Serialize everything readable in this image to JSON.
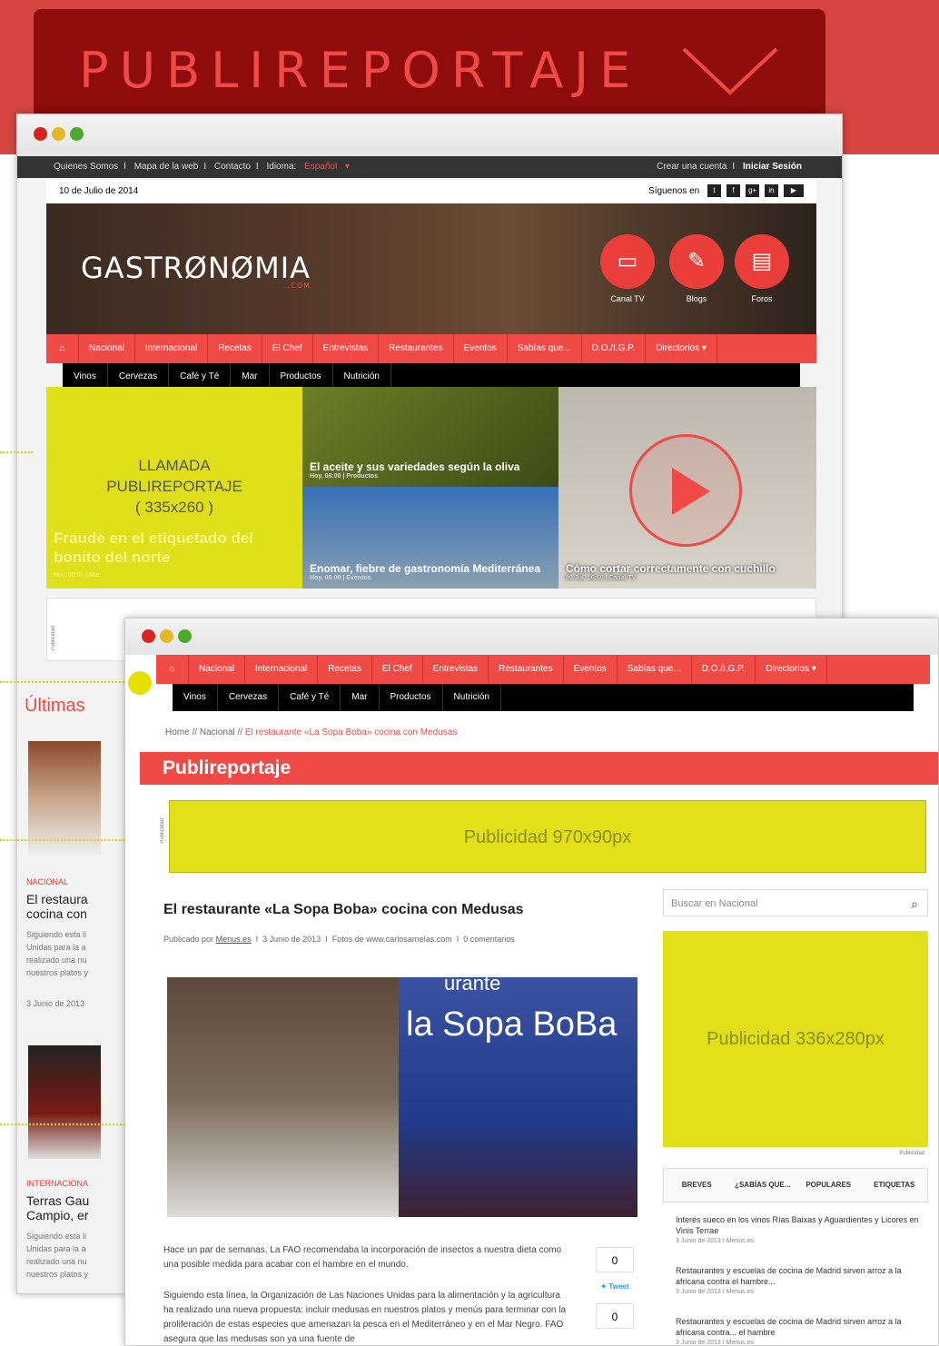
{
  "banner": {
    "title": "PUBLIREPORTAJE"
  },
  "colors": {
    "accent": "#f04a46",
    "ad_yellow": "#e1e01a",
    "banner_dark": "#8e0c0c"
  },
  "window1": {
    "topbar": {
      "links": [
        "Quienes Somos",
        "Mapa de la web",
        "Contacto"
      ],
      "idioma_label": "Idioma:",
      "idioma_value": "Español",
      "crear": "Crear una cuenta",
      "iniciar": "Iniciar Sesión"
    },
    "date": "10 de Julio de 2014",
    "siguenos": "Síguenos en",
    "logo": "GASTRØNØMIA",
    "logo_suffix": ".COM",
    "channels": [
      "Canal TV",
      "Blogs",
      "Foros"
    ],
    "nav": [
      "Nacional",
      "Internacional",
      "Recetas",
      "El Chef",
      "Entrevistas",
      "Restaurantes",
      "Eventos",
      "Sabías que...",
      "D.O./I.G.P.",
      "Directorios"
    ],
    "subnav": [
      "Vinos",
      "Cervezas",
      "Café y Té",
      "Mar",
      "Productos",
      "Nutrición"
    ],
    "tile1": {
      "callout1": "LLAMADA",
      "callout2": "PUBLIREPORTAJE",
      "callout3": "( 335x260 )",
      "title": "Fraude en el etiquetado del bonito del norte",
      "meta": "Hoy, 08:00 | Mar"
    },
    "tile2a": {
      "title": "El aceite y sus variedades según la oliva",
      "meta": "Hoy, 08:00 | Productos"
    },
    "tile2b": {
      "title": "Enomar, fiebre de gastronomía Mediterránea",
      "meta": "Hoy, 08:00 | Eventos"
    },
    "tile3": {
      "title": "Cómo cortar correctamente con cuchillo",
      "meta": "09 Jul, 16:50 | Canal TV"
    },
    "publicidad": "Publicidad",
    "ultimas": "Últimas",
    "card1": {
      "tag": "NACIONAL",
      "title1": "El restaura",
      "title2": "cocina con",
      "text": [
        "Siguiendo esta li",
        "Unidas para la a",
        "realizado una nu",
        "nuestros platos y"
      ],
      "date": "3 Junio de 2013"
    },
    "card2": {
      "tag": "INTERNACIONA",
      "title1": "Terras Gau",
      "title2": "Campio, er",
      "text": [
        "Siguiendo esta li",
        "Unidas para la a",
        "realizado una nu",
        "nuestros platos y"
      ]
    }
  },
  "window2": {
    "nav": [
      "Nacional",
      "Internacional",
      "Recetas",
      "El Chef",
      "Entrevistas",
      "Restaurantes",
      "Eventos",
      "Sabías que...",
      "D.O./I.G.P.",
      "Directorios"
    ],
    "subnav": [
      "Vinos",
      "Cervezas",
      "Café y Té",
      "Mar",
      "Productos",
      "Nutrición"
    ],
    "breadcrumb": {
      "home": "Home",
      "sep": "//",
      "section": "Nacional",
      "current": "El restaurante «La Sopa Boba» cocina con Medusas"
    },
    "section_title": "Publireportaje",
    "ad_top": "Publicidad 970x90px",
    "publicidad": "Publicidad",
    "article": {
      "title": "El restaurante «La Sopa Boba» cocina con Medusas",
      "meta_by": "Publicado por",
      "meta_author": "Menus.es",
      "meta_date": "3 Junio de 2013",
      "meta_photos": "Fotos de www.carlosarnelas.com",
      "meta_comments": "0 comentarios",
      "sign_line1": "la Sopa",
      "sign_line2": "BoBa",
      "sign_top": "urante",
      "p1": "Hace un par de semanas, La FAO recomendaba la incorporación de insectos a nuestra dieta como una posible medida para acabar con el hambre en el mundo.",
      "p2": "Siguiendo esta línea, la Organización de Las Naciones Unidas para la alimentación y la agricultura ha realizado una nueva propuesta: incluir medusas en nuestros platos y menús para terminar con la proliferación de estas especies que amenazan la pesca en el Mediterráneo y en el Mar Negro. FAO asegura que las medusas son ya una fuente de",
      "share_count1": "0",
      "tweet": "Tweet",
      "share_count2": "0"
    },
    "sidebar": {
      "search_placeholder": "Buscar en Nacional",
      "ad": "Publicidad 336x280px",
      "tabs": [
        "BREVES",
        "¿SABÍAS QUE...",
        "POPULARES",
        "ETIQUETAS"
      ],
      "news": [
        {
          "title": "Interés sueco en los vinos Rías Baixas y Aguardientes y Licores en Vinis Terrae",
          "date": "3 Junio de 2013",
          "author": "Menus.es"
        },
        {
          "title": "Restaurantes y escuelas de cocina de Madrid sirven arroz a la africana contra el hambre...",
          "date": "3 Junio de 2013",
          "author": "Menus.es"
        },
        {
          "title": "Restaurantes y escuelas de cocina de Madrid sirven arroz a la africana contra... el hambre",
          "date": "3 Junio de 2013",
          "author": "Menus.es"
        }
      ]
    }
  }
}
